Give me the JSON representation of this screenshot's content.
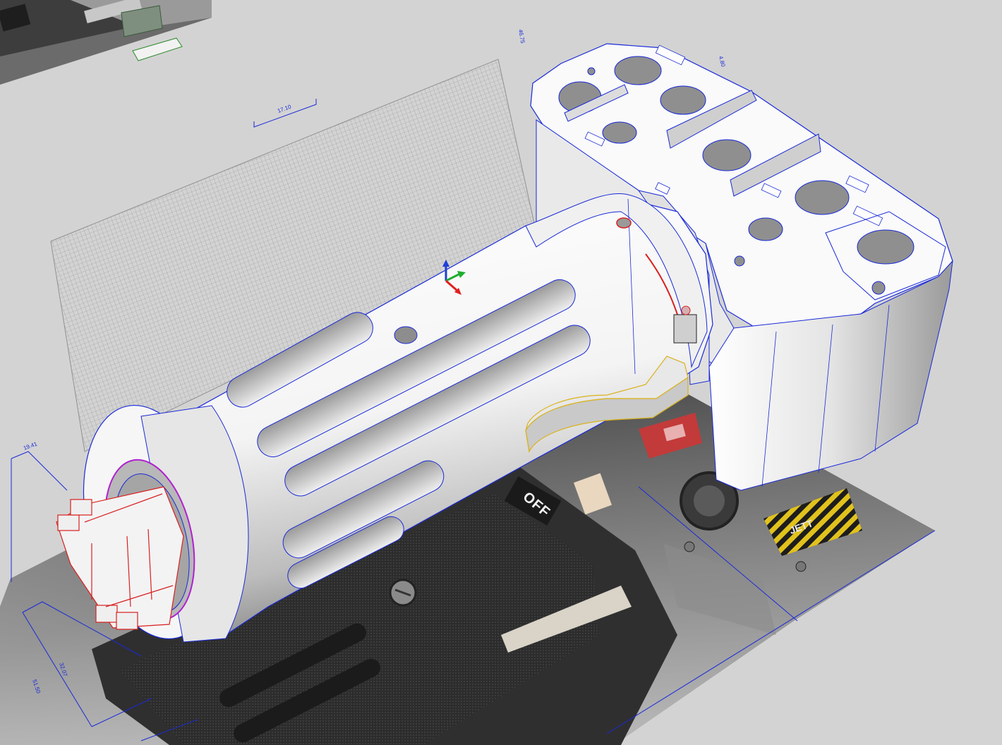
{
  "viewport": {
    "name": "3D CAD viewport",
    "background": "#d3d3d3",
    "edge_color": "#1a2ad8",
    "selection_color": "#d92020",
    "highlight_color": "#d9b21c"
  },
  "dimensions": {
    "top_a": "46.75",
    "top_b": "4.80",
    "top_c": "17.10",
    "left_a": "19.41",
    "left_b": "32.07",
    "left_c": "51.50"
  },
  "photo_labels": {
    "switch": "OFF",
    "plate": "JETT"
  },
  "gizmo": {
    "x_color": "#e02020",
    "y_color": "#1fae2f",
    "z_color": "#1f3fd8"
  }
}
